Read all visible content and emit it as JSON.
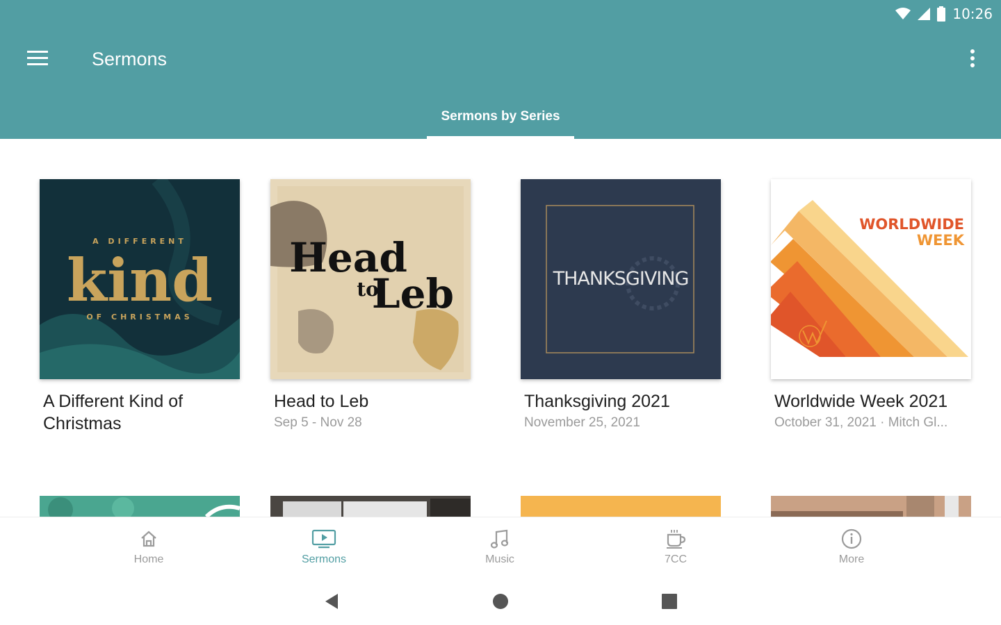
{
  "status_bar": {
    "time": "10:26"
  },
  "app_bar": {
    "title": "Sermons"
  },
  "tabs": [
    {
      "label": "Sermons by Series",
      "selected": true
    }
  ],
  "series": [
    {
      "title": "A Different Kind of Christmas",
      "subtitle": "",
      "artwork": {
        "top_line": "A DIFFERENT",
        "main": "kind",
        "bottom_line": "OF CHRISTMAS"
      }
    },
    {
      "title": "Head to Leb",
      "subtitle": "Sep 5 - Nov 28",
      "artwork": {
        "line1": "Head",
        "line2": "to",
        "line3": "Leb"
      }
    },
    {
      "title": "Thanksgiving 2021",
      "subtitle": "November 25, 2021",
      "artwork": {
        "text": "THANKSGIVING"
      }
    },
    {
      "title": "Worldwide Week 2021",
      "subtitle": "October 31, 2021 · Mitch Gl...",
      "artwork": {
        "line1": "WORLDWIDE",
        "line2": "WEEK"
      }
    }
  ],
  "bottom_nav": {
    "items": [
      {
        "label": "Home",
        "icon": "home-icon",
        "active": false
      },
      {
        "label": "Sermons",
        "icon": "tv-play-icon",
        "active": true
      },
      {
        "label": "Music",
        "icon": "music-note-icon",
        "active": false
      },
      {
        "label": "7CC",
        "icon": "coffee-cup-icon",
        "active": false
      },
      {
        "label": "More",
        "icon": "info-icon",
        "active": false
      }
    ]
  },
  "colors": {
    "primary": "#529ea3",
    "active_nav": "#529ea3",
    "inactive_nav": "#9b9b9b"
  }
}
